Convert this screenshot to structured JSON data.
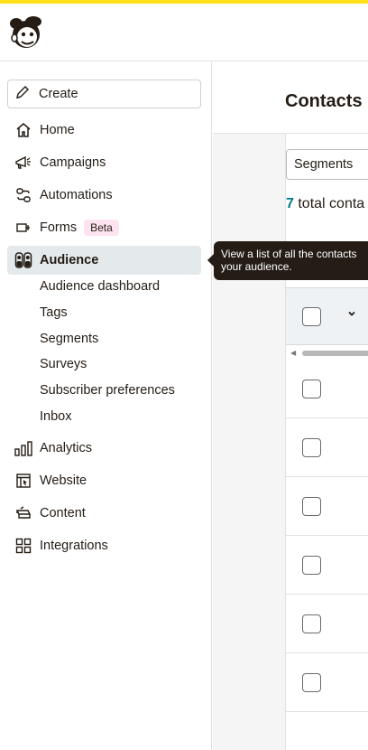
{
  "brand": {
    "accent_color": "#ffe01b",
    "logo_icon": "mailchimp-freddie-icon"
  },
  "sidebar": {
    "create": {
      "label": "Create",
      "icon": "pencil-icon"
    },
    "items": [
      {
        "label": "Home",
        "icon": "home-icon"
      },
      {
        "label": "Campaigns",
        "icon": "megaphone-icon"
      },
      {
        "label": "Automations",
        "icon": "automation-icon"
      },
      {
        "label": "Forms",
        "icon": "form-icon",
        "badge": "Beta"
      },
      {
        "label": "Audience",
        "icon": "audience-icon",
        "active": true
      },
      {
        "label": "Analytics",
        "icon": "bar-chart-icon"
      },
      {
        "label": "Website",
        "icon": "website-icon"
      },
      {
        "label": "Content",
        "icon": "content-icon"
      },
      {
        "label": "Integrations",
        "icon": "integrations-icon"
      }
    ],
    "audience_subitems": [
      "Audience dashboard",
      "Tags",
      "Segments",
      "Surveys",
      "Subscriber preferences",
      "Inbox"
    ]
  },
  "tooltip": {
    "text": "View a list of all the contacts your audience."
  },
  "main": {
    "title": "Contacts",
    "segments_select": "Segments",
    "total_count": "7",
    "total_label": " total conta"
  },
  "colors": {
    "active_bg": "#e4e9ec",
    "badge_bg": "#fde3f0",
    "count_color": "#007c89",
    "tooltip_bg": "#241c15"
  }
}
